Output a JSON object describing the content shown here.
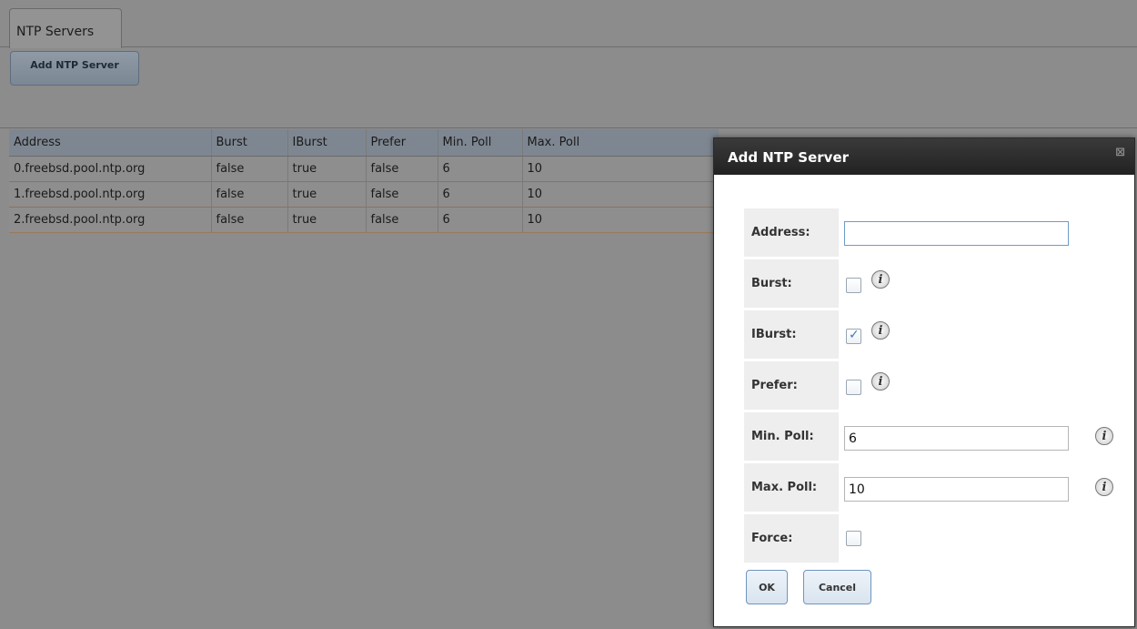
{
  "tabs": [
    {
      "label": "NTP Servers"
    }
  ],
  "toolbar": {
    "add_label": "Add NTP Server"
  },
  "table": {
    "columns": [
      "Address",
      "Burst",
      "IBurst",
      "Prefer",
      "Min. Poll",
      "Max. Poll"
    ],
    "rows": [
      [
        "0.freebsd.pool.ntp.org",
        "false",
        "true",
        "false",
        "6",
        "10"
      ],
      [
        "1.freebsd.pool.ntp.org",
        "false",
        "true",
        "false",
        "6",
        "10"
      ],
      [
        "2.freebsd.pool.ntp.org",
        "false",
        "true",
        "false",
        "6",
        "10"
      ]
    ]
  },
  "dialog": {
    "title": "Add NTP Server",
    "close_glyph": "⊠",
    "fields": {
      "address": {
        "label": "Address:",
        "value": ""
      },
      "burst": {
        "label": "Burst:",
        "checked": false
      },
      "iburst": {
        "label": "IBurst:",
        "checked": true
      },
      "prefer": {
        "label": "Prefer:",
        "checked": false
      },
      "minpoll": {
        "label": "Min. Poll:",
        "value": "6"
      },
      "maxpoll": {
        "label": "Max. Poll:",
        "value": "10"
      },
      "force": {
        "label": "Force:",
        "checked": false
      }
    },
    "info_glyph": "i",
    "ok_label": "OK",
    "cancel_label": "Cancel"
  }
}
